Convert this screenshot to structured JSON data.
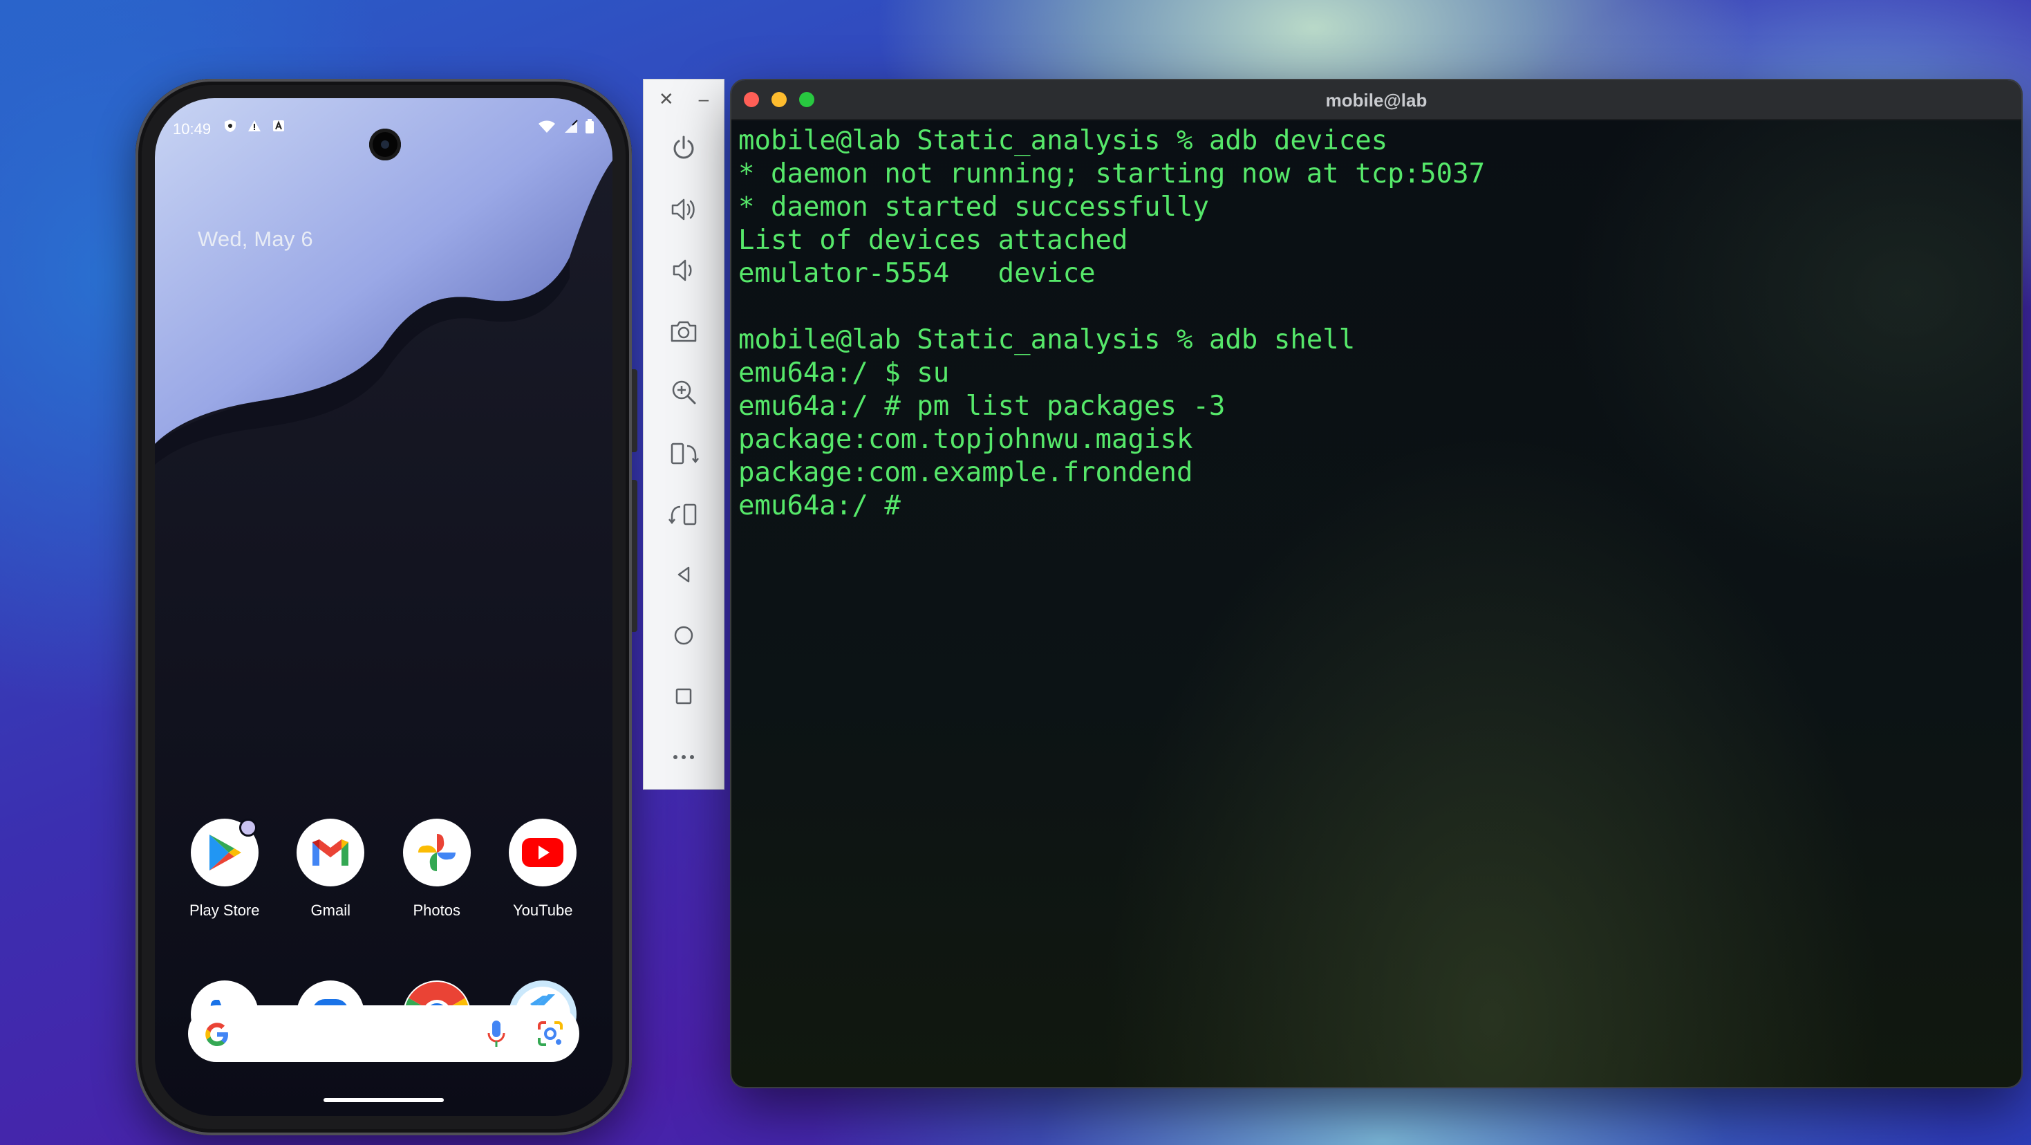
{
  "phone": {
    "status_time": "10:49",
    "date": "Wed, May 6",
    "apps_row1": [
      {
        "label": "Play Store",
        "icon": "play-store-icon"
      },
      {
        "label": "Gmail",
        "icon": "gmail-icon"
      },
      {
        "label": "Photos",
        "icon": "photos-icon"
      },
      {
        "label": "YouTube",
        "icon": "youtube-icon"
      }
    ],
    "apps_row2": [
      {
        "icon": "phone-icon"
      },
      {
        "icon": "messages-icon"
      },
      {
        "icon": "chrome-icon"
      },
      {
        "icon": "flutter-icon"
      }
    ],
    "search_bar": {
      "icons": [
        "google-g-icon",
        "microphone-icon",
        "lens-icon"
      ]
    }
  },
  "emulator_toolbar": {
    "buttons": [
      "power-icon",
      "volume-up-icon",
      "volume-down-icon",
      "camera-icon",
      "zoom-icon",
      "rotate-left-icon",
      "rotate-right-icon",
      "back-icon",
      "home-icon",
      "overview-icon",
      "more-icon"
    ]
  },
  "terminal": {
    "title": "mobile@lab",
    "lines": [
      "mobile@lab Static_analysis % adb devices",
      "* daemon not running; starting now at tcp:5037",
      "* daemon started successfully",
      "List of devices attached",
      "emulator-5554   device",
      "",
      "mobile@lab Static_analysis % adb shell",
      "emu64a:/ $ su",
      "emu64a:/ # pm list packages -3",
      "package:com.topjohnwu.magisk",
      "package:com.example.frondend",
      "emu64a:/ # "
    ],
    "text_color": "#56e86a"
  }
}
